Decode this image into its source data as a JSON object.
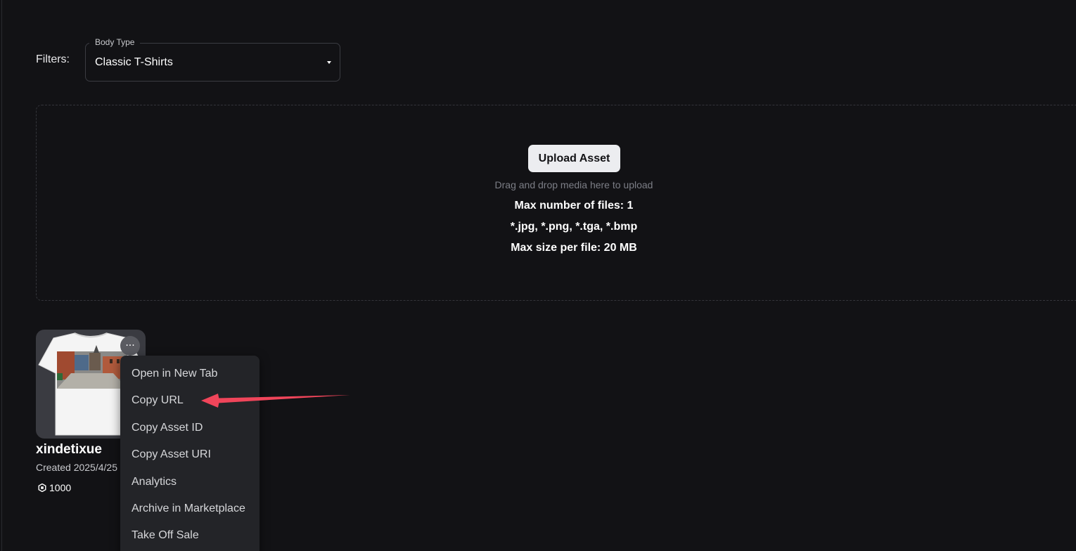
{
  "filters": {
    "label": "Filters:",
    "body_type": {
      "legend": "Body Type",
      "value": "Classic T-Shirts"
    }
  },
  "dropzone": {
    "upload_label": "Upload Asset",
    "hint": "Drag and drop media here to upload",
    "max_files": "Max number of files: 1",
    "formats": "*.jpg, *.png, *.tga, *.bmp",
    "max_size": "Max size per file: 20 MB"
  },
  "asset": {
    "name": "xindetixue",
    "created": "Created 2025/4/25",
    "price": "1000",
    "more_label": "···"
  },
  "context_menu": {
    "items": [
      "Open in New Tab",
      "Copy URL",
      "Copy Asset ID",
      "Copy Asset URI",
      "Analytics",
      "Archive in Marketplace",
      "Take Off Sale"
    ]
  },
  "colors": {
    "background": "#121215",
    "menu_background": "#232428",
    "annotation_arrow": "#f0455a"
  }
}
